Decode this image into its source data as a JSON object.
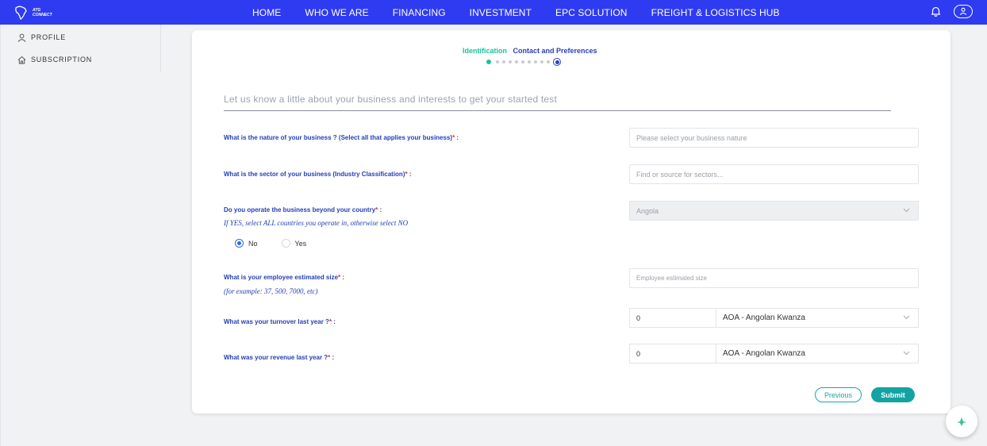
{
  "nav": {
    "logo_text": [
      "ATG",
      "CONNECT"
    ],
    "items": [
      "HOME",
      "WHO WE ARE",
      "FINANCING",
      "INVESTMENT",
      "EPC SOLUTION",
      "FREIGHT & LOGISTICS HUB"
    ],
    "icons": [
      "bell-icon",
      "user-icon"
    ]
  },
  "sidebar": {
    "items": [
      {
        "label": "PROFILE",
        "icon": "user-icon"
      },
      {
        "label": "SUBSCRIPTION",
        "icon": "home-icon"
      }
    ]
  },
  "stepper": {
    "active_label": "Identification",
    "next_label": "Contact and Preferences",
    "total_dots": 11,
    "current_index": 0
  },
  "form": {
    "intro": "Let us know a little about your business and interests to get your started test",
    "nature": {
      "label": "What is the nature of your business ? (Select all that applies your business)",
      "placeholder": "Please select your business nature"
    },
    "sector": {
      "label": "What is the sector of your business (Industry Classification)",
      "placeholder": "Find or source for sectors..."
    },
    "beyond": {
      "label": "Do you operate the business beyond your country",
      "hint": "If YES, select ALL countries you operate in, otherwise select NO",
      "country_value": "Angola",
      "options": [
        "No",
        "Yes"
      ],
      "selected": "No"
    },
    "employees": {
      "label": "What is your employee estimated size",
      "hint": "(for example: 37, 500, 7000, etc)",
      "placeholder": "Employee estimated size"
    },
    "turnover": {
      "label": "What was your turnover last year ?",
      "amount": "0",
      "currency": "AOA - Angolan Kwanza"
    },
    "revenue": {
      "label": "What was your revenue last year ?",
      "amount": "0",
      "currency": "AOA - Angolan Kwanza"
    },
    "required_mark": "*",
    "label_suffix": " :"
  },
  "buttons": {
    "previous": "Previous",
    "submit": "Submit"
  },
  "colors": {
    "nav_bg": "#2f3bf0",
    "step_active": "#19c39a",
    "label_blue": "#2440b5",
    "teal": "#13a3a3",
    "required": "#e03030"
  }
}
